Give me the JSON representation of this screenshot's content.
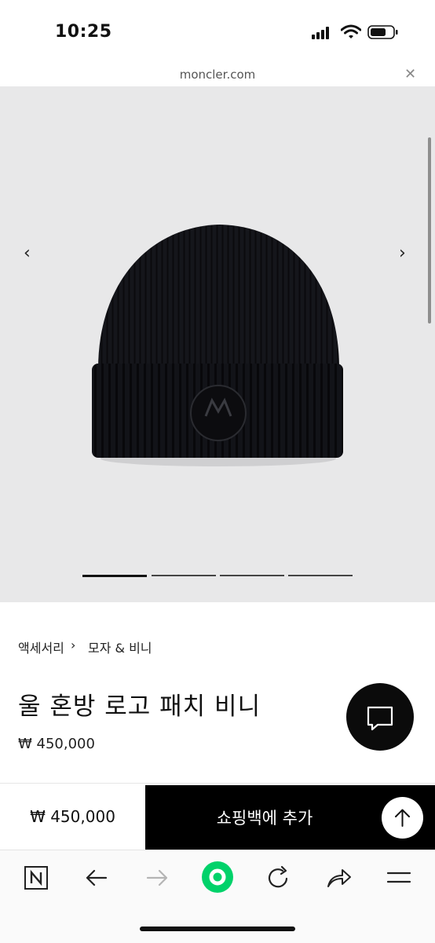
{
  "status_bar": {
    "time": "10:25"
  },
  "url_bar": {
    "domain": "moncler.com"
  },
  "gallery": {
    "slide_count": 4,
    "active_index": 0
  },
  "breadcrumb": {
    "category": "액세서리",
    "separator": "›",
    "subcategory": "모자 & 비니"
  },
  "product": {
    "title": "울 혼방 로고 패치 비니",
    "price": "₩ 450,000"
  },
  "sticky_bar": {
    "price": "₩ 450,000",
    "add_to_bag": "쇼핑백에 추가"
  },
  "colors": {
    "accent_green": "#00d26a",
    "button_black": "#000000",
    "hero_bg": "#e8e8e9"
  }
}
